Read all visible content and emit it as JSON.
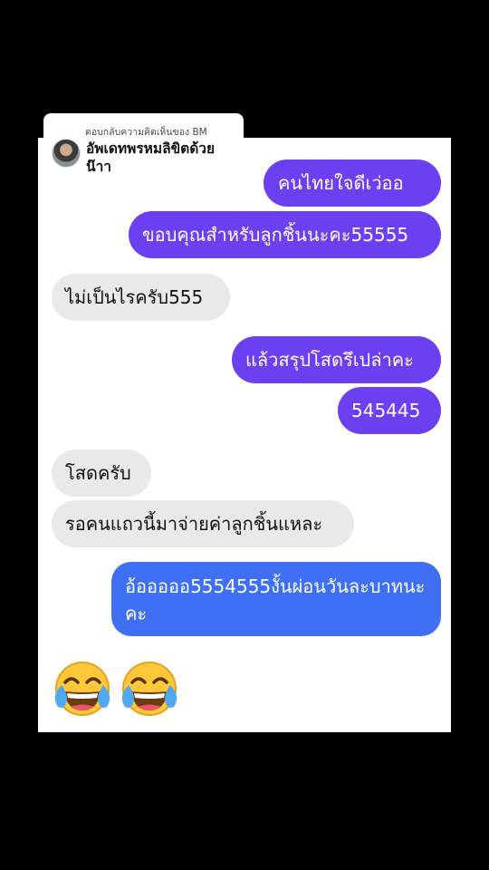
{
  "reply": {
    "caption": "ตอบกลับความคิดเห็นของ BM",
    "comment": "อัพเดทพรหมลิขิตด้วยน๊าา"
  },
  "messages": [
    {
      "text": "คนไทยใจดีเว่ออ"
    },
    {
      "text": "ขอบคุณสำหรับลูกชิ้นนะคะ55555"
    },
    {
      "text": "ไม่เป็นไรครับ555"
    },
    {
      "text": "แล้วสรุปโสดรึเปล่าคะ"
    },
    {
      "text": "545445"
    },
    {
      "text": "โสดครับ"
    },
    {
      "text": "รอคนแถวนี้มาจ่ายค่าลูกชิ้นแหละ"
    },
    {
      "text": "อ้อออออ5554555งั้นผ่อนวันละบาทนะคะ"
    }
  ],
  "emojis": [
    "face-with-tears-of-joy",
    "face-with-tears-of-joy"
  ],
  "colors": {
    "outgoing": "#6c3ff0",
    "incoming": "#e9e9ea",
    "outgoing_alt": "#3f6ff2"
  }
}
